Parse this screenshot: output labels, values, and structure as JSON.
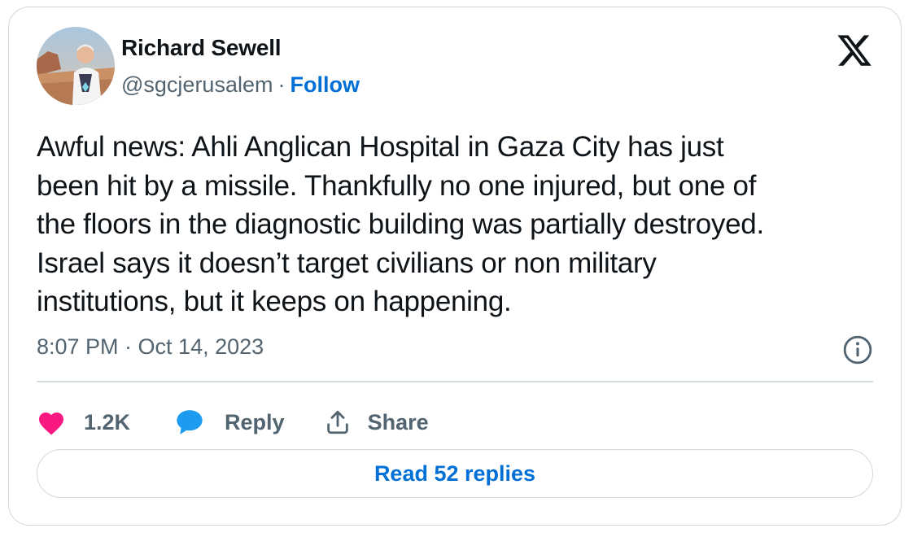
{
  "author": {
    "name": "Richard Sewell",
    "handle": "@sgcjerusalem",
    "separator": "·",
    "follow_label": "Follow"
  },
  "tweet": {
    "text": "Awful news: Ahli Anglican Hospital in Gaza City has just\nbeen hit by a missile. Thankfully no one injured, but one of\nthe floors in the diagnostic building was partially destroyed.\nIsrael says it doesn’t target civilians or non military\ninstitutions, but it keeps on happening.",
    "timestamp": "8:07 PM · Oct 14, 2023"
  },
  "actions": {
    "like_count": "1.2K",
    "reply_label": "Reply",
    "share_label": "Share"
  },
  "read_replies_label": "Read 52 replies",
  "icons": {
    "brand": "x-logo-icon",
    "info": "info-icon",
    "like": "heart-icon",
    "reply": "speech-bubble-icon",
    "share": "share-upload-icon"
  },
  "colors": {
    "like": "#f91880",
    "reply": "#1d9bf0",
    "link": "#006fd6",
    "secondary_text": "#536471",
    "border": "#cfd9de"
  }
}
